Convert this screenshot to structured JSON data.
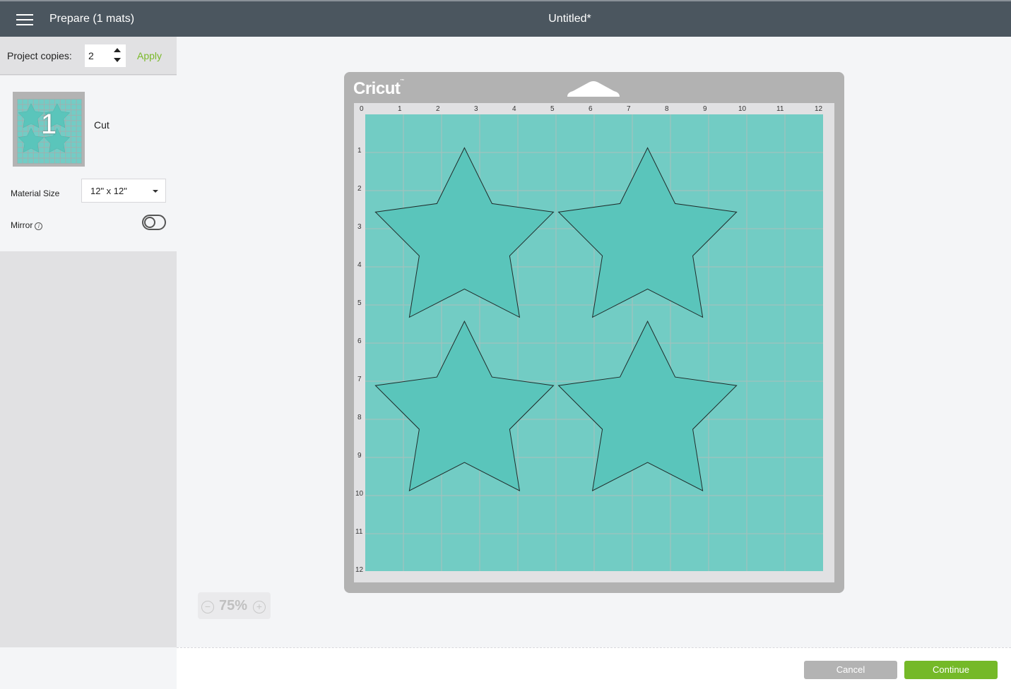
{
  "header": {
    "menu_icon": "hamburger-menu-icon",
    "prepare_title": "Prepare (1 mats)",
    "document_title": "Untitled*"
  },
  "sidebar": {
    "project_copies_label": "Project copies:",
    "project_copies_value": "2",
    "apply_label": "Apply",
    "mats": [
      {
        "number": "1",
        "label": "Cut"
      }
    ],
    "material_size_label": "Material Size",
    "material_size_value": "12\" x 12\"",
    "mirror_label": "Mirror",
    "mirror_info_icon": "info-icon",
    "mirror_enabled": false
  },
  "mat": {
    "brand": "Cricut",
    "brand_tm": "™",
    "size_inches": [
      12,
      12
    ],
    "ruler_top": [
      "0",
      "1",
      "2",
      "3",
      "4",
      "5",
      "6",
      "7",
      "8",
      "9",
      "10",
      "11",
      "12"
    ],
    "ruler_left": [
      "1",
      "2",
      "3",
      "4",
      "5",
      "6",
      "7",
      "8",
      "9",
      "10",
      "11",
      "12"
    ],
    "color": "#72ccc4",
    "shape_color": "#5ac5bb",
    "shapes": [
      {
        "type": "star",
        "center_in": [
          2.6,
          3.1
        ]
      },
      {
        "type": "star",
        "center_in": [
          7.4,
          3.1
        ]
      },
      {
        "type": "star",
        "center_in": [
          2.6,
          7.65
        ]
      },
      {
        "type": "star",
        "center_in": [
          7.4,
          7.65
        ]
      }
    ]
  },
  "zoom": {
    "value": "75%",
    "minus_icon": "zoom-out-icon",
    "plus_icon": "zoom-in-icon"
  },
  "footer": {
    "cancel_label": "Cancel",
    "continue_label": "Continue"
  },
  "colors": {
    "header_bg": "#4b565f",
    "accent_green": "#75b928",
    "apply_green": "#7ab929"
  }
}
